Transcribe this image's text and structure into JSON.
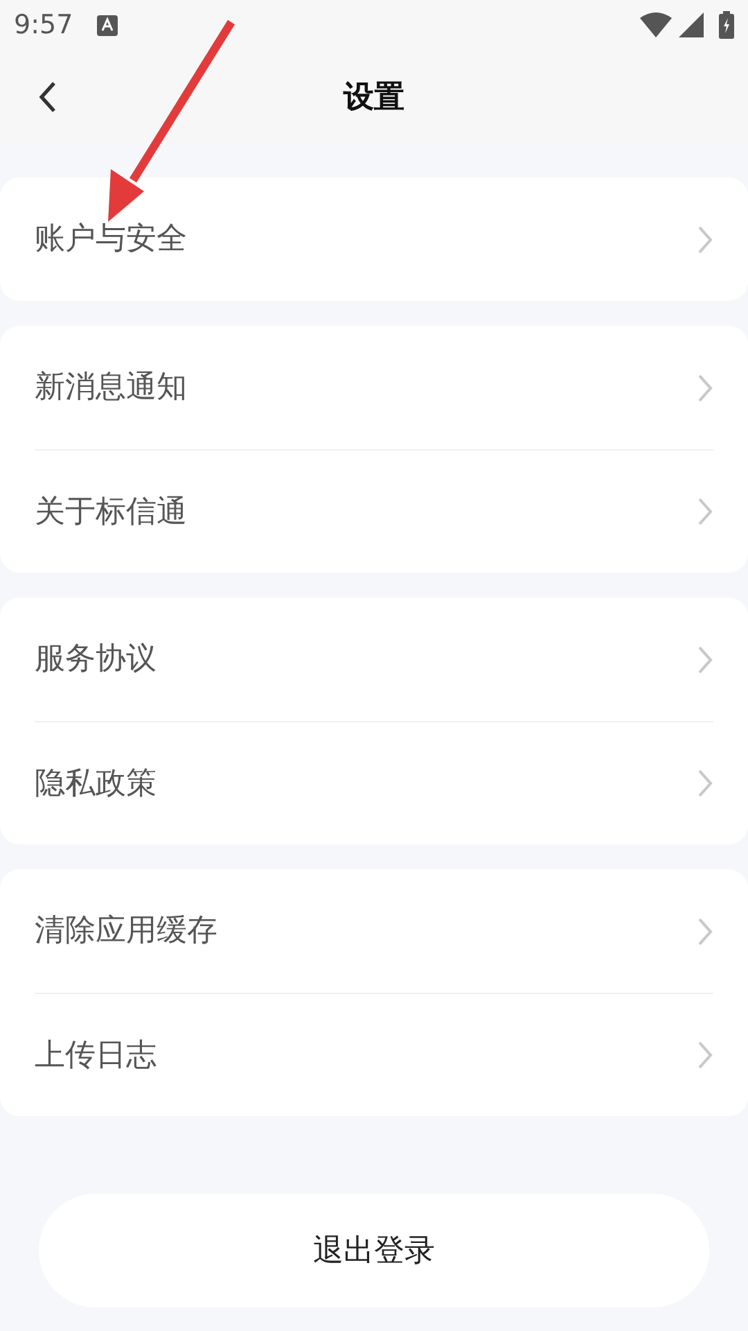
{
  "status_bar": {
    "time": "9:57"
  },
  "header": {
    "title": "设置"
  },
  "groups": [
    {
      "items": [
        {
          "label": "账户与安全"
        }
      ]
    },
    {
      "items": [
        {
          "label": "新消息通知"
        },
        {
          "label": "关于标信通"
        }
      ]
    },
    {
      "items": [
        {
          "label": "服务协议"
        },
        {
          "label": "隐私政策"
        }
      ]
    },
    {
      "items": [
        {
          "label": "清除应用缓存"
        },
        {
          "label": "上传日志"
        }
      ]
    }
  ],
  "logout_button": "退出登录"
}
